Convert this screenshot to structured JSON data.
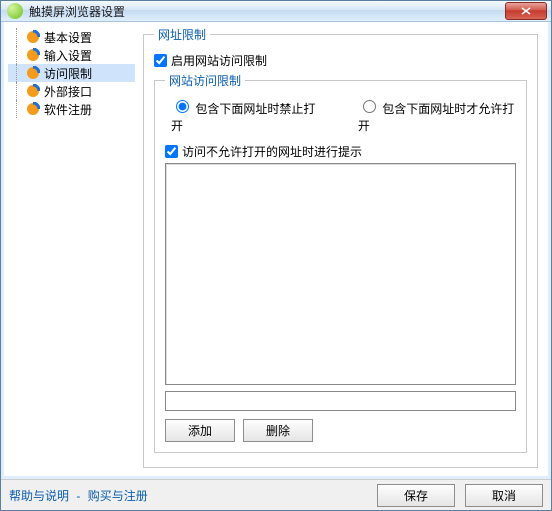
{
  "window": {
    "title": "触摸屏浏览器设置"
  },
  "sidebar": {
    "items": [
      {
        "label": "基本设置"
      },
      {
        "label": "输入设置"
      },
      {
        "label": "访问限制"
      },
      {
        "label": "外部接口"
      },
      {
        "label": "软件注册"
      }
    ],
    "selected_index": 2
  },
  "panel": {
    "groupbox_outer_legend": "网址限制",
    "enable_label": "启用网站访问限制",
    "enable_checked": true,
    "groupbox_inner_legend": "网站访问限制",
    "radio_block_label": "包含下面网址时禁止打开",
    "radio_allow_label": "包含下面网址时才允许打开",
    "radio_selected": "block",
    "prompt_label": "访问不允许打开的网址时进行提示",
    "prompt_checked": true,
    "url_list": [],
    "url_input_value": "",
    "add_button": "添加",
    "delete_button": "删除"
  },
  "footer": {
    "help_link": "帮助与说明",
    "buy_link": "购买与注册",
    "save_button": "保存",
    "cancel_button": "取消"
  }
}
